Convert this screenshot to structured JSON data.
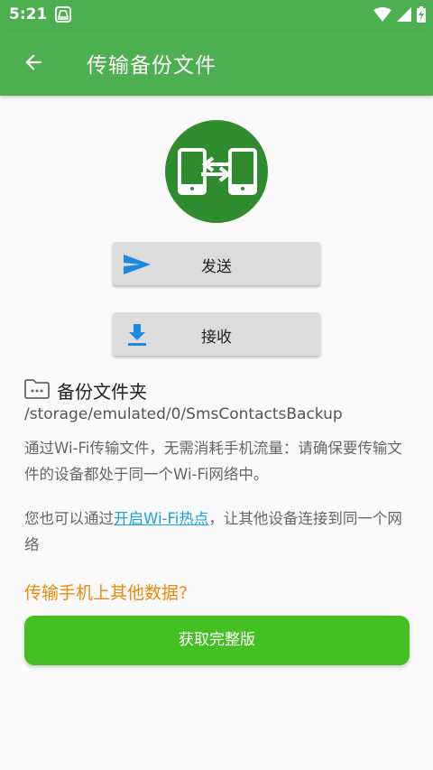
{
  "status_bar": {
    "time": "5:21"
  },
  "app_bar": {
    "title": "传输备份文件"
  },
  "buttons": {
    "send_label": "发送",
    "receive_label": "接收"
  },
  "folder": {
    "title": "备份文件夹",
    "path": "/storage/emulated/0/SmsContactsBackup"
  },
  "info": {
    "paragraph1": "通过Wi-Fi传输文件，无需消耗手机流量：请确保要传输文件的设备都处于同一个Wi-Fi网络中。",
    "paragraph2_prefix": "您也可以通过",
    "paragraph2_link": "开启Wi-Fi热点",
    "paragraph2_suffix": "，让其他设备连接到同一个网络"
  },
  "promo": {
    "question": "传输手机上其他数据?",
    "full_version_label": "获取完整版"
  },
  "icons": {
    "app_status": "app-notification-icon",
    "wifi": "wifi-icon",
    "signal": "signal-icon",
    "battery": "battery-icon",
    "back": "back-arrow-icon",
    "hero": "phone-transfer-icon",
    "send": "send-icon",
    "receive": "download-icon",
    "folder": "folder-icon"
  },
  "colors": {
    "primary": "#4caf50",
    "hero_circle": "#2e8b2e",
    "send_icon": "#1e88e5",
    "link": "#1aa3d9",
    "promo_text": "#ee8a0b",
    "full_version_button": "#44c023"
  }
}
